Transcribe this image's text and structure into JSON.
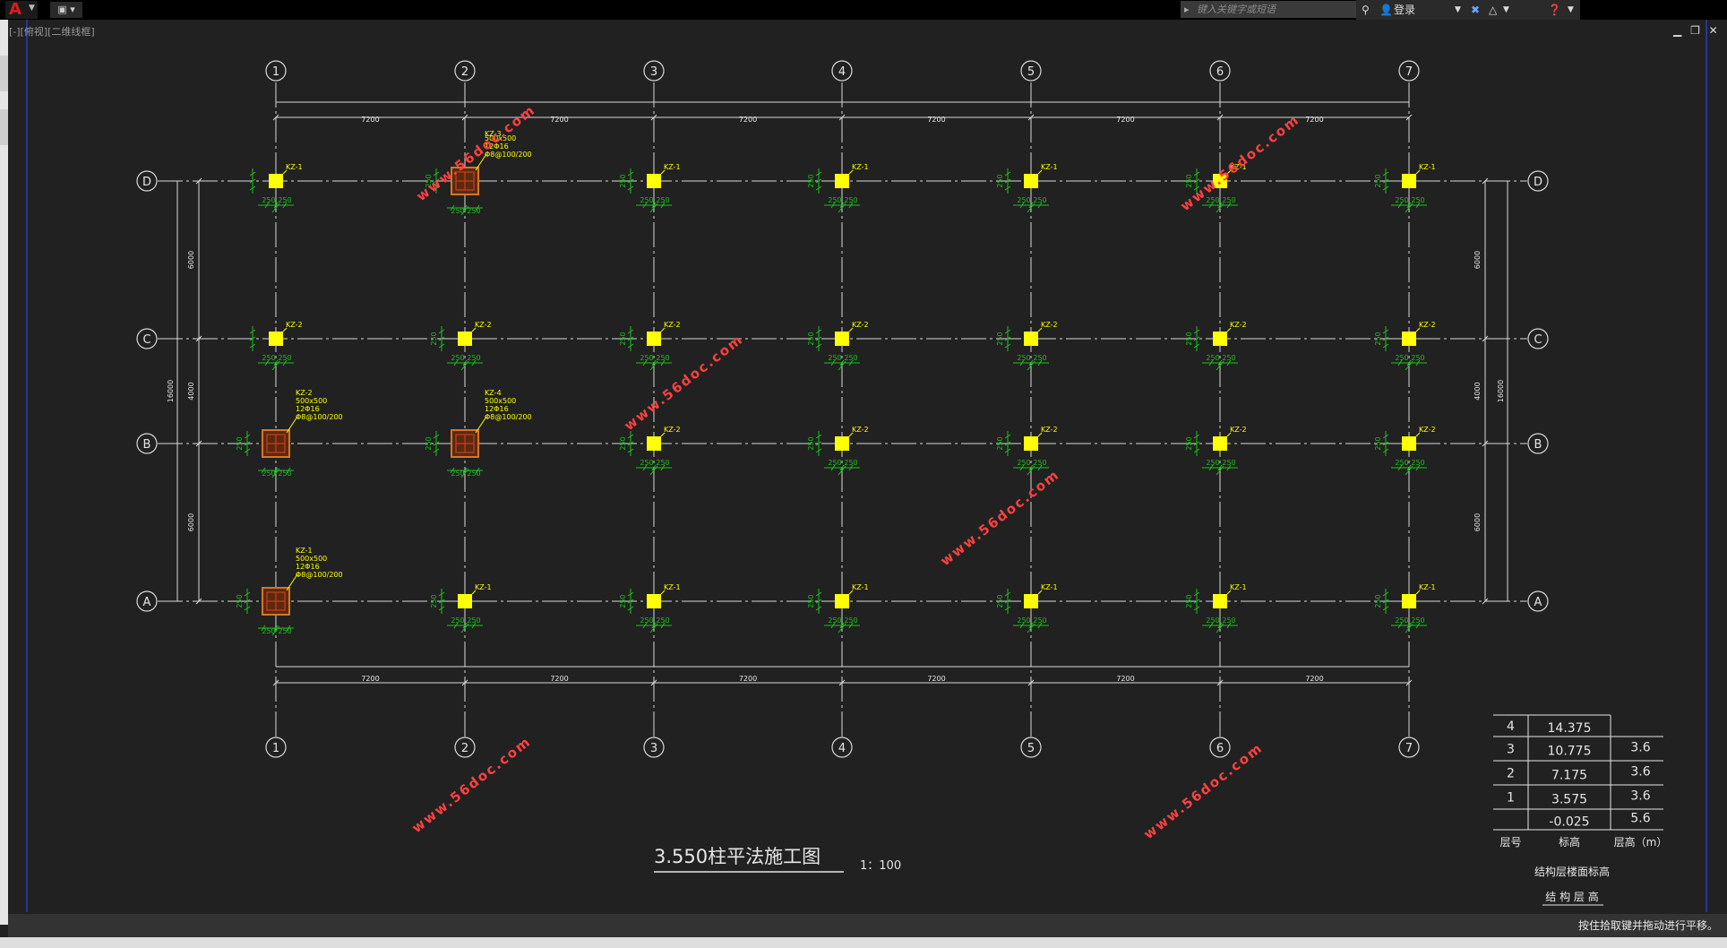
{
  "app": {
    "logo_icon": "autocad-logo-icon",
    "view_label": "[-][俯视][二维线框]",
    "search_placeholder": "键入关键字或短语",
    "login_label": "登录",
    "status_text": "按住拾取键并拖动进行平移。"
  },
  "colors": {
    "background": "#212121",
    "grid_line": "#d9d9d9",
    "column": "#ffff00",
    "rebar": "#d4752a",
    "dimension": "#1fbf1f",
    "watermark": "#ff4040",
    "text": "#e6e6e6"
  },
  "drawing": {
    "axes_x": [
      "1",
      "2",
      "3",
      "4",
      "5",
      "6",
      "7"
    ],
    "axes_y": [
      "D",
      "C",
      "B",
      "A"
    ],
    "bay_dims": [
      "7200",
      "7200",
      "7200",
      "7200",
      "7200",
      "7200"
    ],
    "side_dims": [
      "6000",
      "4000",
      "6000"
    ],
    "total_depth": "16000",
    "col_dim": "250",
    "title": "3.550柱平法施工图",
    "scale": "1：100",
    "watermark": "www.56doc.com",
    "columns": [
      [
        "KZ-1",
        "KZ-3",
        "KZ-1",
        "KZ-1",
        "KZ-1",
        "KZ-1",
        "KZ-1"
      ],
      [
        "KZ-2",
        "KZ-2",
        "KZ-2",
        "KZ-2",
        "KZ-2",
        "KZ-2",
        "KZ-2"
      ],
      [
        "KZ-2",
        "KZ-4",
        "KZ-2",
        "KZ-2",
        "KZ-2",
        "KZ-2",
        "KZ-2"
      ],
      [
        "KZ-1",
        "KZ-1",
        "KZ-1",
        "KZ-1",
        "KZ-1",
        "KZ-1",
        "KZ-1"
      ]
    ],
    "details": [
      {
        "row": 0,
        "col": 1,
        "lines": [
          "500x500",
          "12Φ16",
          "Φ8@100/200"
        ]
      },
      {
        "row": 2,
        "col": 0,
        "lines": [
          "KZ-2",
          "500x500",
          "12Φ16",
          "Φ8@100/200"
        ]
      },
      {
        "row": 2,
        "col": 1,
        "lines": [
          "KZ-4",
          "500x500",
          "12Φ16",
          "Φ8@100/200"
        ]
      },
      {
        "row": 3,
        "col": 0,
        "lines": [
          "KZ-1",
          "500x500",
          "12Φ16",
          "Φ8@100/200"
        ]
      }
    ]
  },
  "level_table": {
    "rows": [
      {
        "floor": "4",
        "elevation": "14.375",
        "height": ""
      },
      {
        "floor": "3",
        "elevation": "10.775",
        "height": "3.6"
      },
      {
        "floor": "2",
        "elevation": "7.175",
        "height": "3.6"
      },
      {
        "floor": "1",
        "elevation": "3.575",
        "height": "3.6"
      },
      {
        "floor": "",
        "elevation": "-0.025",
        "height": "5.6"
      }
    ],
    "header": {
      "floor": "层号",
      "elevation": "标高",
      "height": "层高（m）"
    },
    "caption1": "结构层楼面标高",
    "caption2": "结 构 层 高"
  }
}
